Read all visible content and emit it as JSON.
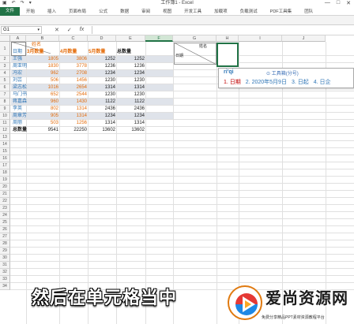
{
  "window": {
    "title": "工作簿1 - Excel"
  },
  "quick_access": {
    "save": "▣",
    "undo": "↶",
    "redo": "↷",
    "customize": "▾"
  },
  "window_controls": {
    "minimize": "—",
    "maximize": "□",
    "close": "✕"
  },
  "ribbon": {
    "tabs": [
      "文件",
      "开始",
      "插入",
      "页面布局",
      "公式",
      "数据",
      "审阅",
      "视图",
      "开发工具",
      "加载项",
      "负载测试",
      "PDF工具集",
      "团队"
    ]
  },
  "formula_bar": {
    "name_box": "G1",
    "cancel": "✕",
    "enter": "✓",
    "fx": "fx",
    "value": ""
  },
  "columns": [
    "A",
    "B",
    "C",
    "D",
    "E",
    "F",
    "G",
    "H",
    "I",
    "J"
  ],
  "selected_column": "F",
  "rows": [
    "1",
    "2",
    "3",
    "4",
    "5",
    "6",
    "7",
    "8",
    "9",
    "10",
    "11",
    "12",
    "13",
    "14",
    "15",
    "16",
    "17",
    "18",
    "19",
    "20",
    "21",
    "22",
    "23",
    "24",
    "25",
    "26",
    "27",
    "28",
    "29",
    "30",
    "31",
    "32",
    "33",
    "34"
  ],
  "table": {
    "header_top": "姓名",
    "header_bottom": "日期",
    "month_headers": [
      "3月数量",
      "4月数量",
      "5月数量",
      "总数量"
    ],
    "names": [
      "王强",
      "周亚明",
      "冯宏",
      "刘芸",
      "梁志松",
      "马门书",
      "蒋嘉森",
      "李英",
      "周章芳",
      "周丽"
    ],
    "rows": [
      [
        "1805",
        "3806",
        "1252",
        "1252"
      ],
      [
        "1830",
        "3778",
        "1236",
        "1236"
      ],
      [
        "962",
        "2708",
        "1234",
        "1234"
      ],
      [
        "506",
        "1456",
        "1230",
        "1230"
      ],
      [
        "1016",
        "2654",
        "1314",
        "1314"
      ],
      [
        "652",
        "2544",
        "1230",
        "1230"
      ],
      [
        "960",
        "1430",
        "1122",
        "1122"
      ],
      [
        "802",
        "1314",
        "2436",
        "2436"
      ],
      [
        "905",
        "1314",
        "1234",
        "1234"
      ],
      [
        "503",
        "1256",
        "1314",
        "1314"
      ]
    ],
    "total_label": "总数量",
    "totals": [
      "9541",
      "22250",
      "13602",
      "13602"
    ]
  },
  "small_header": {
    "top": "姓名",
    "bottom": "日期"
  },
  "ime": {
    "composition": "ri'qi",
    "toolbox_label": "工具箱(分号)",
    "candidates": [
      "1. 日期",
      "2. 2020年5月9日",
      "3. 日起",
      "4. 日企"
    ]
  },
  "subtitle": "然后在单元格当中",
  "watermark": {
    "brand": "爱尚资源网",
    "tagline": "免费分享精品PPT素材资源教程平台"
  },
  "colors": {
    "accent": "#217346",
    "orange_text": "#e46c0a",
    "blue_text": "#2e75b6"
  }
}
